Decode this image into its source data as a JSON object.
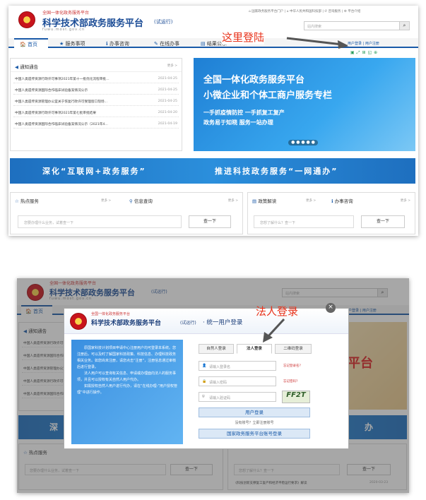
{
  "site": {
    "org_top": "全国一体化政务服务平台",
    "title": "科学技术部政务服务平台",
    "trial": "(试运行)",
    "url": "fuwu.most.gov.cn",
    "top_links": "⌂ 国家政务服务平台门户  |  ⌂ 中华人民共和国科技部  |  ✆ 咨询服务  |  ⚙ 平台介绍",
    "search_placeholder": "站内搜索",
    "search_icon": "search-icon"
  },
  "nav": [
    "首页",
    "服务事项",
    "办事咨询",
    "在线办事",
    "结果公示"
  ],
  "account": {
    "login": "用户登录",
    "register": "用户注册"
  },
  "annotations": {
    "login_here": "这里登陆",
    "corp_login": "法人登录"
  },
  "notice": {
    "title": "通知通告",
    "more": "更多 >",
    "items": [
      {
        "text": "中国人类遗传资源行政许可事项2021年第十一批优化流程审批...",
        "date": "2021-04-25"
      },
      {
        "text": "中国人类遗传资源国际合作临床试验备案情况公示",
        "date": "2021-04-25"
      },
      {
        "text": "中国人类遗传资源管理办公室关于恢复行政许可受理窗口现场...",
        "date": "2021-04-25"
      },
      {
        "text": "中国人类遗传资源行政许可事项2021年第七批审批结果",
        "date": "2021-04-20"
      },
      {
        "text": "中国人类遗传资源国际合作临床试验备案情况公示（2021年4...",
        "date": "2021-04-19"
      }
    ]
  },
  "banner": {
    "line1": "全国一体化政务服务平台",
    "line2": "小微企业和个体工商户服务专栏",
    "slogan1": "一手抓疫情防控 一手抓复工复产",
    "slogan2": "政务易于知晓 服务一站办理"
  },
  "strip": {
    "left": "深化“互联网+政务服务”",
    "right": "推进科技政务服务“一网通办”"
  },
  "lower": {
    "hot": "热点服务",
    "info": "信息查询",
    "policy": "政策解读",
    "consult": "办事咨询",
    "more": "更多 >",
    "hot_placeholder": "您要办理什么业务，试着查一下",
    "policy_placeholder": "您想了解什么？查一下",
    "btn": "查一下"
  },
  "modal": {
    "title": "科学技术部政务服务平台",
    "trial": "(试运行)",
    "subtitle": "· 统一用户登录",
    "org_top": "全国一体化政务服务平台",
    "intro1": "原国家科技计划项目申请中心注册用户均可登录本系统。您注册后，可以及时了解国家科技政策、科技信息、办理科技政务相关业务。如您尚未注册，请您点击“注册”，注册信息通过审核后进行登录。",
    "intro2": "法人用户可以查询有关信息、申请或办理面向法人的服务事项，并且可以授权有关自然人用户代办。",
    "intro3": "如需授权自然人用户进行代办，请在“在线办理-”用户授权管理”中进行操作。",
    "tabs": [
      "自然人登录",
      "法人登录",
      "二维码登录"
    ],
    "fields": [
      "请输入登录名",
      "请输入密码",
      "请输入验证码"
    ],
    "forgot_user": "忘记登录名?",
    "forgot_pwd": "忘记密码?",
    "captcha": "FF2T",
    "login_btn": "用户登录",
    "no_account": "没有账号？立即注册账号",
    "national_btn": "国家政务服务平台账号登录",
    "close": "×"
  },
  "bg2": {
    "policy_item": "《科技创新支撑复工复产和经济平稳运行要求》解读",
    "policy_date": "2020-03-23",
    "partial_banner": "平台",
    "partial_strip": "办"
  }
}
